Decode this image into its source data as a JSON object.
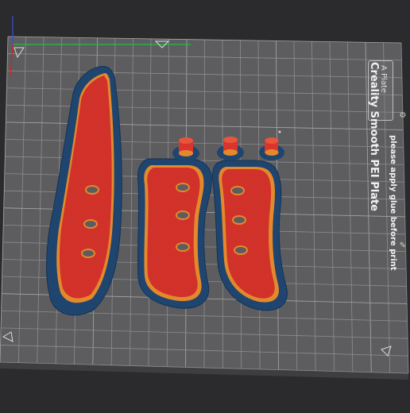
{
  "plate": {
    "name": "A Plate",
    "surface_title": "Creality Smooth PEI Plate",
    "glue_note": "please apply glue before print"
  },
  "colors": {
    "background": "#2b2b2d",
    "plate_fill": "#5a5a5c",
    "grid_line": "#8a8a8c",
    "part_red": "#d9352d",
    "part_orange": "#e3892b",
    "brim_blue": "#1b3e66",
    "axis_x": "#20c040",
    "axis_y": "#3a4ad8",
    "axis_z": "#d22222"
  },
  "icons": {
    "edit": "pencil-icon",
    "plate_settings": "gear-icon"
  }
}
